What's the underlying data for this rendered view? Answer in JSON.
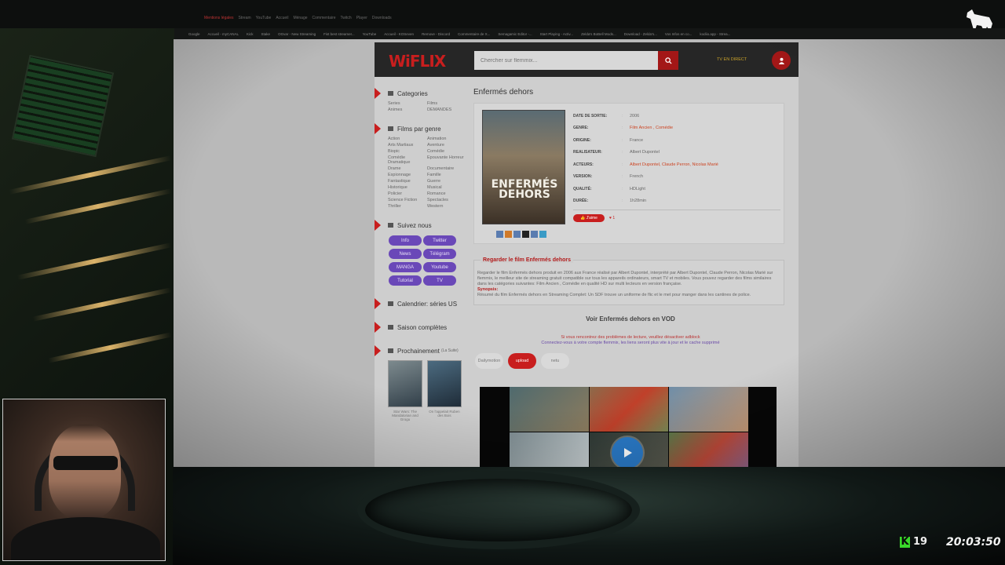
{
  "browser": {
    "tabs": [
      "Mentions légales",
      "Stream",
      "YouTube",
      "Accueil",
      "Ménage",
      "Commentaire",
      "Twitch",
      "Player",
      "Downloads"
    ],
    "bookmarks": [
      "Google",
      "Accueil - myCANAL",
      "Kick",
      "Stake",
      "OGvar - New Streaming",
      "Fist best streamer...",
      "YouTube",
      "Accueil - KOSeven",
      "Remove - Discord",
      "Commentaire de X...",
      "Semagamic Editor -...",
      "Start Playing - Activ...",
      "Zelda's BoBell Mods...",
      "Download - Zelda's...",
      "Vos Infos en co...",
      "kodiio.app - Strea..."
    ]
  },
  "site": {
    "brand_accent": "Wi",
    "brand_rest": "FLIX",
    "search_placeholder": "Chercher sur flemmix...",
    "tv_link": "TV EN DIRECT",
    "sidebar": {
      "categories_title": "Categories",
      "categories": [
        "Series",
        "Films",
        "Animes",
        "DEMANDES"
      ],
      "genres_title": "Films par genre",
      "genres": [
        "Action",
        "Animation",
        "Arts Martiaux",
        "Aventure",
        "Biopic",
        "Comédie",
        "Comédie Dramatique",
        "Epouvante Horreur",
        "Drame",
        "Documentaire",
        "Espionnage",
        "Famille",
        "Fantastique",
        "Guerre",
        "Historique",
        "Musical",
        "Policier",
        "Romance",
        "Science Fiction",
        "Spectacles",
        "Thriller",
        "Western"
      ],
      "follow_title": "Suivez nous",
      "social": [
        "Info",
        "Twitter",
        "News",
        "Télégram",
        "MANGA",
        "Youtube",
        "Tutorial",
        "TV"
      ],
      "calendar_title": "Calendrier: séries US",
      "seasons_title": "Saison complètes",
      "upcoming_title": "Prochainement",
      "upcoming_suffix": "(La Suite)",
      "upcoming": [
        {
          "caption": "Star Wars: The Mandalorian and Grogu"
        },
        {
          "caption": "On l'appelait Ruben des Bois"
        }
      ]
    },
    "movie": {
      "title": "Enfermés dehors",
      "poster_title": "ENFERMÉS DEHORS",
      "facts": [
        {
          "key": "DATE DE SORTIE:",
          "value": "2006",
          "link": false
        },
        {
          "key": "GENRE:",
          "value": "Film Ancien , Comédie",
          "link": true
        },
        {
          "key": "ORIGINE:",
          "value": "France",
          "link": false
        },
        {
          "key": "REALISATEUR:",
          "value": "Albert Dupontel",
          "link": false
        },
        {
          "key": "ACTEURS:",
          "value": "Albert Dupontel, Claude Perron, Nicolas Marié",
          "link": true
        },
        {
          "key": "VERSION:",
          "value": "French",
          "link": false
        },
        {
          "key": "QUALITÉ:",
          "value": "HDLight",
          "link": false
        },
        {
          "key": "DURÉE:",
          "value": "1h28min",
          "link": false
        }
      ],
      "like_label": "J'aime",
      "like_count": "♥ 1",
      "watch_title": "Regarder le film Enfermés dehors",
      "description": "Regarder le film Enfermés dehors produit en 2006 aux France réalisé par Albert Dupontel, interprété par Albert Dupontel, Claude Perron, Nicolas Marié sur flemmix, le meilleur site de streaming gratuit compatible sur tous les appareils ordinateurs, smart TV et mobiles. Vous pouvez regarder des films similaires dans les catégories suivantes: Film Ancien , Comédie en qualité HD sur multi lecteurs en version française.",
      "synopsis_label": "Synopsis:",
      "synopsis": "Résumé du film Enfermés dehors en Streaming Complet: Un SDF trouve un uniforme de flic et le met pour manger dans les cantines de police.",
      "vod": "Voir Enfermés dehors en VOD",
      "notice_red": "Si vous rencontrez des problèmes de lecture, veuillez désactiver adblock",
      "notice_purple": "Connectez-vous à votre compte flemmix, les liens seront plus vite à jour et le cache supprimé",
      "players": [
        "Dailymotion",
        "upload",
        "netu"
      ]
    }
  },
  "overlay": {
    "kick_count": "19",
    "clock": "20:03:50"
  },
  "colors": {
    "brand_red": "#c81e1e",
    "social_purple": "#6a48b8",
    "kick_green": "#39d82a"
  }
}
